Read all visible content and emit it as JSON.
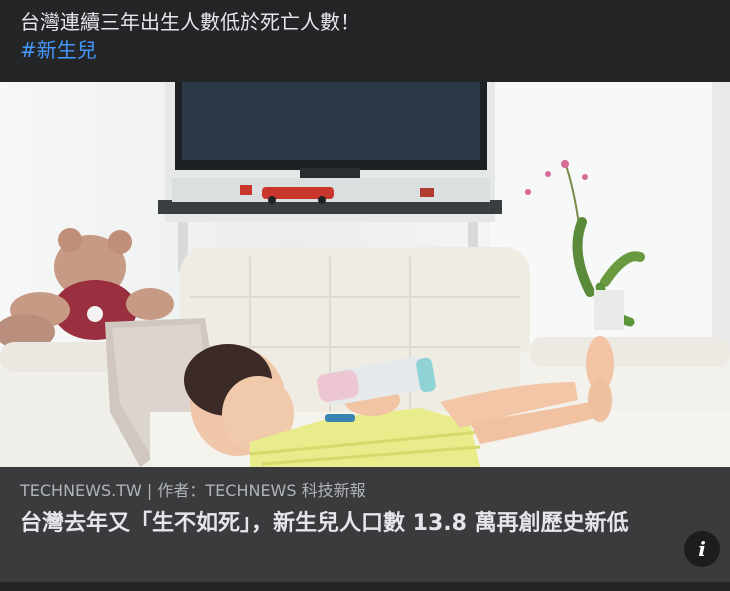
{
  "post": {
    "caption": "台灣連續三年出生人數低於死亡人數！",
    "hashtag": "#新生兒"
  },
  "link_card": {
    "source": "TECHNEWS.TW | 作者：TECHNEWS 科技新報",
    "title": "台灣去年又「生不如死」，新生兒人口數 13.8 萬再創歷史新低",
    "info_icon_glyph": "i",
    "image_alt": "baby drinking from bottle on white sofa"
  },
  "colors": {
    "background": "#242526",
    "meta_background": "#3a3b3c",
    "hashtag": "#4599ff",
    "text_primary": "#e4e6eb",
    "text_secondary": "#b0b3b8"
  }
}
